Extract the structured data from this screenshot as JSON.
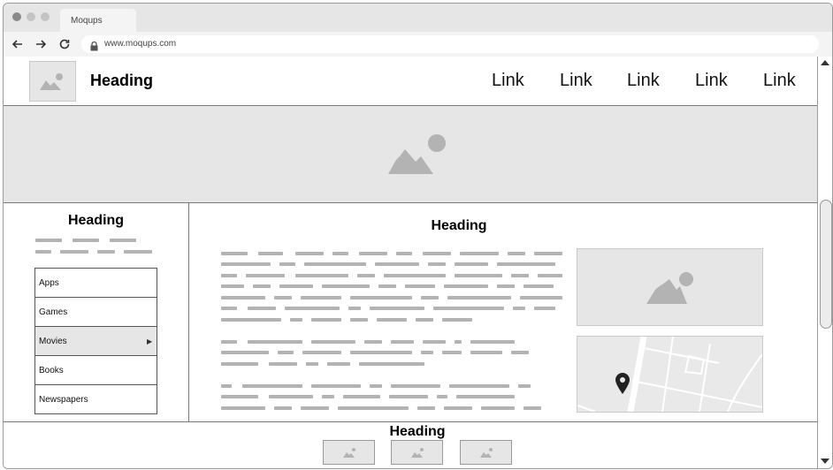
{
  "browser": {
    "tab_title": "Moqups",
    "url": "www.moqups.com"
  },
  "header": {
    "logo_icon": "image-placeholder-icon",
    "title": "Heading",
    "links": [
      "Link",
      "Link",
      "Link",
      "Link",
      "Link"
    ]
  },
  "hero": {
    "icon": "image-placeholder-icon"
  },
  "sidebar": {
    "title": "Heading",
    "menu": [
      {
        "label": "Apps"
      },
      {
        "label": "Games"
      },
      {
        "label": "Movies",
        "active": true,
        "submenu_icon": "caret-right-icon"
      },
      {
        "label": "Books"
      },
      {
        "label": "Newspapers"
      }
    ]
  },
  "main": {
    "title": "Heading",
    "image_icon": "image-placeholder-icon",
    "map_icon": "map-pin-icon"
  },
  "footer": {
    "title": "Heading",
    "thumbnails": [
      "image-placeholder-icon",
      "image-placeholder-icon",
      "image-placeholder-icon"
    ]
  },
  "colors": {
    "placeholder_fill": "#e6e6e6",
    "placeholder_icon": "#b3b3b3",
    "border": "#7a7a7a",
    "text": "#111111"
  }
}
